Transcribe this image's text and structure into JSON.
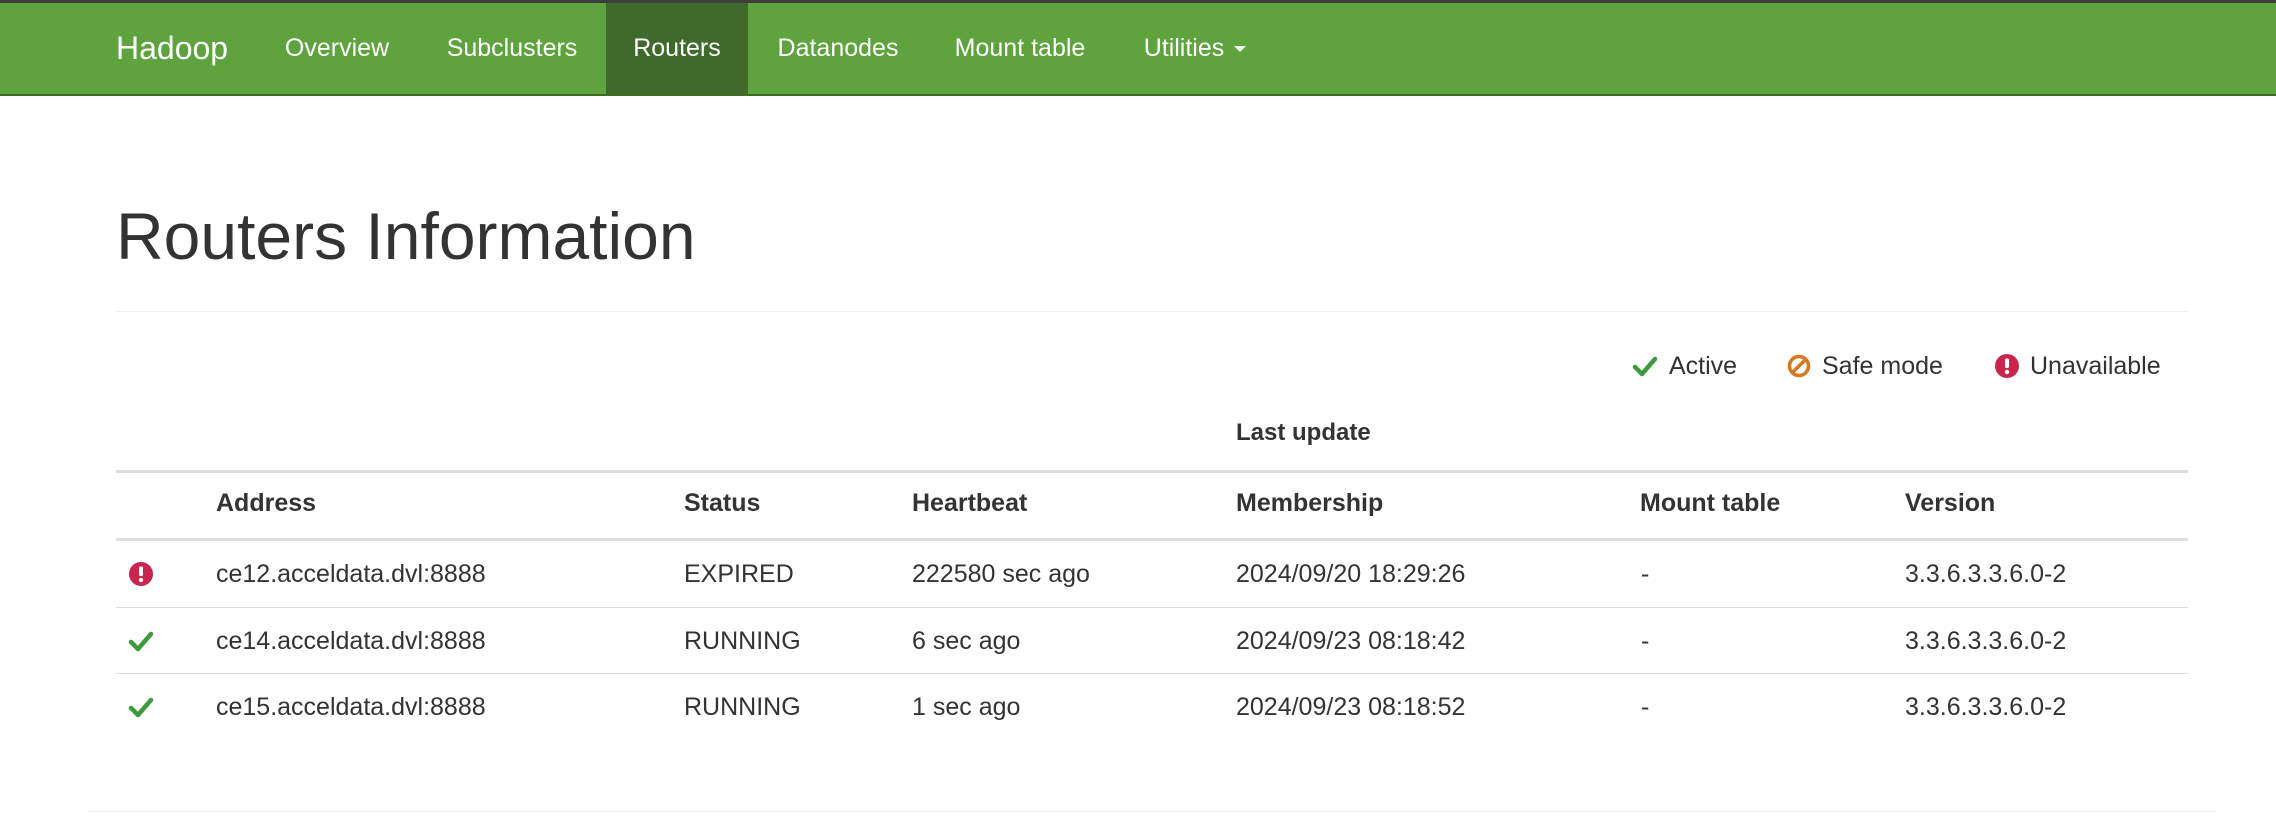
{
  "navbar": {
    "brand": "Hadoop",
    "items": [
      {
        "label": "Overview",
        "active": false
      },
      {
        "label": "Subclusters",
        "active": false
      },
      {
        "label": "Routers",
        "active": true
      },
      {
        "label": "Datanodes",
        "active": false
      },
      {
        "label": "Mount table",
        "active": false
      },
      {
        "label": "Utilities",
        "active": false,
        "has_dropdown": true
      }
    ]
  },
  "page": {
    "title": "Routers Information"
  },
  "legend": {
    "active": {
      "label": "Active",
      "icon": "check-icon",
      "color": "#3d9a3d"
    },
    "safe_mode": {
      "label": "Safe mode",
      "icon": "ban-icon",
      "color": "#d9771c"
    },
    "unavailable": {
      "label": "Unavailable",
      "icon": "exclamation-circle-icon",
      "color": "#c9254d"
    }
  },
  "table": {
    "group_header": "Last update",
    "columns": [
      "Address",
      "Status",
      "Heartbeat",
      "Membership",
      "Mount table",
      "Version"
    ],
    "rows": [
      {
        "state": "unavailable",
        "icon": "exclamation-circle-icon",
        "address": "ce12.acceldata.dvl:8888",
        "status": "EXPIRED",
        "heartbeat": "222580 sec ago",
        "membership": "2024/09/20 18:29:26",
        "mount_table": "-",
        "version": "3.3.6.3.3.6.0-2"
      },
      {
        "state": "active",
        "icon": "check-icon",
        "address": "ce14.acceldata.dvl:8888",
        "status": "RUNNING",
        "heartbeat": "6 sec ago",
        "membership": "2024/09/23 08:18:42",
        "mount_table": "-",
        "version": "3.3.6.3.3.6.0-2"
      },
      {
        "state": "active",
        "icon": "check-icon",
        "address": "ce15.acceldata.dvl:8888",
        "status": "RUNNING",
        "heartbeat": "1 sec ago",
        "membership": "2024/09/23 08:18:52",
        "mount_table": "-",
        "version": "3.3.6.3.3.6.0-2"
      }
    ]
  }
}
